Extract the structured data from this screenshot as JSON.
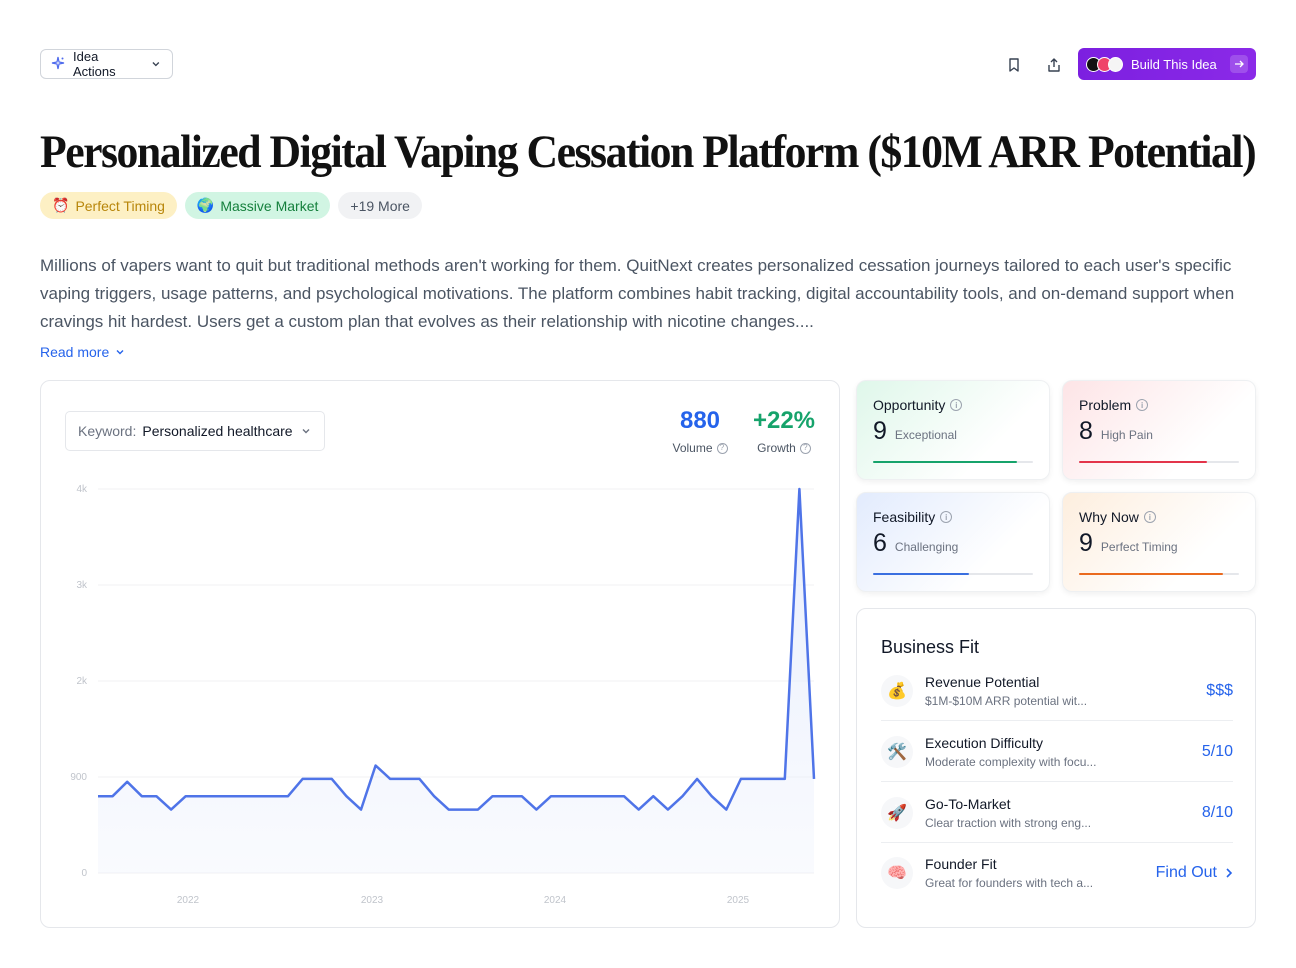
{
  "toolbar": {
    "idea_actions_label": "Idea Actions",
    "build_label": "Build This Idea"
  },
  "title": "Personalized Digital Vaping Cessation Platform ($10M ARR Potential)",
  "tags": [
    {
      "icon": "⏰",
      "label": "Perfect Timing"
    },
    {
      "icon": "🌍",
      "label": "Massive Market"
    },
    {
      "icon": "",
      "label": "+19 More"
    }
  ],
  "description": "Millions of vapers want to quit but traditional methods aren't working for them. QuitNext creates personalized cessation journeys tailored to each user's specific vaping triggers, usage patterns, and psychological motivations. The platform combines habit tracking, digital accountability tools, and on-demand support when cravings hit hardest. Users get a custom plan that evolves as their relationship with nicotine changes....",
  "read_more": "Read more",
  "keyword": {
    "label": "Keyword:",
    "value": "Personalized healthcare"
  },
  "stats": {
    "volume": {
      "value": "880",
      "label": "Volume"
    },
    "growth": {
      "value": "+22%",
      "label": "Growth"
    }
  },
  "chart_data": {
    "type": "area",
    "y_ticks": [
      "0",
      "900",
      "2k",
      "3k",
      "4k"
    ],
    "ylim": [
      0,
      4000
    ],
    "x_ticks": [
      "2022",
      "2023",
      "2024",
      "2025"
    ],
    "values": [
      800,
      800,
      950,
      800,
      800,
      660,
      800,
      800,
      800,
      800,
      800,
      800,
      800,
      800,
      980,
      980,
      980,
      800,
      660,
      1120,
      980,
      980,
      980,
      800,
      660,
      660,
      660,
      800,
      800,
      800,
      660,
      800,
      800,
      800,
      800,
      800,
      800,
      660,
      800,
      660,
      800,
      980,
      800,
      660,
      980,
      980,
      980,
      980,
      4000,
      980
    ],
    "colors": {
      "line": "#4f74e8",
      "fill": "#e8eefc"
    }
  },
  "scores": [
    {
      "title": "Opportunity",
      "score": "9",
      "label": "Exceptional",
      "value": 0.9,
      "color": "#16a36b",
      "bg": "linear-gradient(135deg, #dff7ea 0%, #ffffff 70%)"
    },
    {
      "title": "Problem",
      "score": "8",
      "label": "High Pain",
      "value": 0.8,
      "color": "#e3344a",
      "bg": "linear-gradient(135deg, #fde4e6 0%, #ffffff 70%)"
    },
    {
      "title": "Feasibility",
      "score": "6",
      "label": "Challenging",
      "value": 0.6,
      "color": "#3a6fe0",
      "bg": "linear-gradient(135deg, #e2ebfd 0%, #ffffff 70%)"
    },
    {
      "title": "Why Now",
      "score": "9",
      "label": "Perfect Timing",
      "value": 0.9,
      "color": "#ea6a1e",
      "bg": "linear-gradient(135deg, #fdeede 0%, #ffffff 70%)"
    }
  ],
  "business_fit": {
    "title": "Business Fit",
    "rows": [
      {
        "icon": "💰",
        "title": "Revenue Potential",
        "subtitle": "$1M-$10M ARR potential wit...",
        "value": "$$$"
      },
      {
        "icon": "🛠️",
        "title": "Execution Difficulty",
        "subtitle": "Moderate complexity with focu...",
        "value": "5/10"
      },
      {
        "icon": "🚀",
        "title": "Go-To-Market",
        "subtitle": "Clear traction with strong eng...",
        "value": "8/10"
      },
      {
        "icon": "🧠",
        "title": "Founder Fit",
        "subtitle": "Great for founders with tech a...",
        "value": "Find Out"
      }
    ]
  }
}
